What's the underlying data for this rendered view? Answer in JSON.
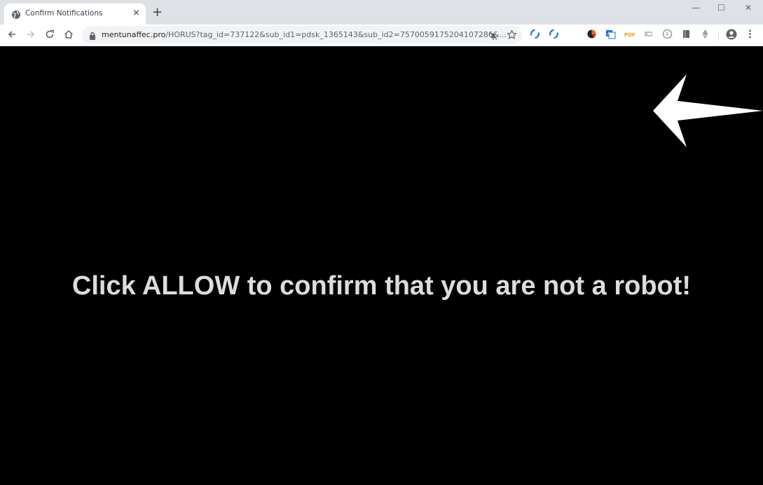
{
  "browser": {
    "tab": {
      "title": "Confirm Notifications",
      "close_glyph": "×",
      "favicon": "globe-icon"
    },
    "new_tab_glyph": "+",
    "window_controls": {
      "minimize": "—",
      "maximize": "☐",
      "close": "✕"
    },
    "nav": {
      "back": "←",
      "forward": "→",
      "reload": "C",
      "home": "⌂"
    },
    "url": {
      "domain": "mentunaffec.pro",
      "path": "/HORUS?tag_id=737122&sub_id1=pdsk_1365143&sub_id2=7570059175204107286&..."
    }
  },
  "page": {
    "headline": "Click ALLOW to confirm that you are not a robot!",
    "background_color": "#000000",
    "arrow_color": "#ffffff"
  }
}
